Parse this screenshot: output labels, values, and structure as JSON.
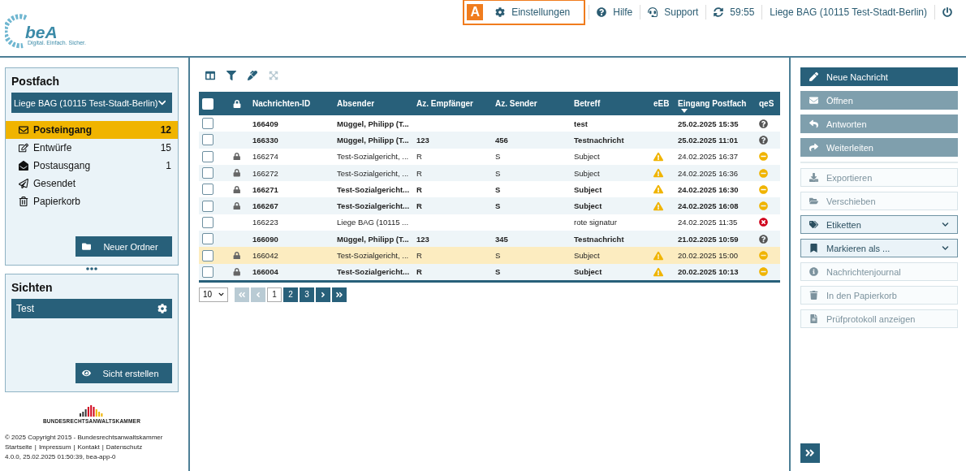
{
  "logo": {
    "name": "beA",
    "tagline": "Digital. Einfach. Sicher."
  },
  "top_bar": [
    {
      "kind": "settings",
      "badge": "A",
      "label": "Einstellungen",
      "highlighted": true
    },
    {
      "kind": "help",
      "label": "Hilfe",
      "highlighted": false
    },
    {
      "kind": "support",
      "label": "Support",
      "highlighted": false
    },
    {
      "kind": "timer",
      "label": "59:55",
      "highlighted": false
    },
    {
      "kind": "account",
      "label": "Liege BAG (10115 Test-Stadt-Berlin)",
      "highlighted": false
    },
    {
      "kind": "logout",
      "highlighted": false
    }
  ],
  "postfach": {
    "title": "Postfach",
    "mailbox": "Liege BAG (10115 Test-Stadt-Berlin)",
    "folders": [
      {
        "label": "Posteingang",
        "count": "12",
        "selected": true
      },
      {
        "label": "Entwürfe",
        "count": "15",
        "selected": false
      },
      {
        "label": "Postausgang",
        "count": "1",
        "selected": false
      },
      {
        "label": "Gesendet",
        "selected": false
      },
      {
        "label": "Papierkorb",
        "selected": false
      }
    ],
    "button": "Neuer Ordner"
  },
  "sichten": {
    "title": "Sichten",
    "views": [
      {
        "label": "Test"
      }
    ],
    "button": "Sicht erstellen"
  },
  "footer": {
    "org": "BUNDESRECHTSANWALTSKAMMER",
    "copyright": "© 2025 Copyright 2015 - Bundesrechtsanwaltskammer",
    "links": [
      "Startseite",
      "Impressum",
      "Kontakt",
      "Datenschutz"
    ],
    "link_separator": "|",
    "version": "4.0.0, 25.02.2025 01:50:39, bea-app-0"
  },
  "toolbar": [
    {
      "kind": "columns",
      "disabled": false
    },
    {
      "kind": "filter",
      "disabled": false
    },
    {
      "kind": "marker",
      "disabled": false
    },
    {
      "kind": "expand",
      "disabled": true
    }
  ],
  "table": {
    "select_all_checked": false,
    "columns": [
      {
        "label": "Nachrichten-ID",
        "sorted": false
      },
      {
        "label": "Absender",
        "sorted": false
      },
      {
        "label": "Az. Empfänger",
        "sorted": false
      },
      {
        "label": "Az. Sender",
        "sorted": false
      },
      {
        "label": "Betreff",
        "sorted": false
      },
      {
        "label": "eEB",
        "sorted": false
      },
      {
        "label": "Eingang Postfach",
        "sorted": true
      },
      {
        "label": "qeS",
        "sorted": false
      }
    ],
    "rows": [
      {
        "checked": false,
        "selected": false,
        "unread": true,
        "locked": false,
        "id": "166409",
        "sender": "Müggel, Philipp (T...",
        "az_recipient": "",
        "az_sender": "",
        "subject": "test",
        "eeb": false,
        "received": "25.02.2025 15:35",
        "kind": "unknown"
      },
      {
        "checked": false,
        "selected": false,
        "unread": true,
        "locked": false,
        "id": "166330",
        "sender": "Müggel, Philipp (T...",
        "az_recipient": "123",
        "az_sender": "456",
        "subject": "Testnachricht",
        "eeb": false,
        "received": "25.02.2025 11:01",
        "kind": "unknown"
      },
      {
        "checked": false,
        "selected": false,
        "unread": false,
        "locked": true,
        "id": "166274",
        "sender": "Test-Sozialgericht, ...",
        "az_recipient": "R",
        "az_sender": "S",
        "subject": "Subject",
        "eeb": true,
        "received": "24.02.2025 16:37",
        "kind": "pending"
      },
      {
        "checked": false,
        "selected": false,
        "unread": false,
        "locked": true,
        "id": "166272",
        "sender": "Test-Sozialgericht, ...",
        "az_recipient": "R",
        "az_sender": "S",
        "subject": "Subject",
        "eeb": true,
        "received": "24.02.2025 16:36",
        "kind": "pending"
      },
      {
        "checked": false,
        "selected": false,
        "unread": true,
        "locked": true,
        "id": "166271",
        "sender": "Test-Sozialgericht...",
        "az_recipient": "R",
        "az_sender": "S",
        "subject": "Subject",
        "eeb": true,
        "received": "24.02.2025 16:30",
        "kind": "pending"
      },
      {
        "checked": false,
        "selected": false,
        "unread": true,
        "locked": true,
        "id": "166267",
        "sender": "Test-Sozialgericht...",
        "az_recipient": "R",
        "az_sender": "S",
        "subject": "Subject",
        "eeb": true,
        "received": "24.02.2025 16:08",
        "kind": "pending"
      },
      {
        "checked": false,
        "selected": false,
        "unread": false,
        "locked": false,
        "id": "166223",
        "sender": "Liege BAG (10115 ...",
        "az_recipient": "",
        "az_sender": "",
        "subject": "rote signatur",
        "eeb": false,
        "received": "24.02.2025 11:35",
        "kind": "invalid"
      },
      {
        "checked": false,
        "selected": false,
        "unread": true,
        "locked": false,
        "id": "166090",
        "sender": "Müggel, Philipp (T...",
        "az_recipient": "123",
        "az_sender": "345",
        "subject": "Testnachricht",
        "eeb": false,
        "received": "21.02.2025 10:59",
        "kind": "unknown"
      },
      {
        "checked": false,
        "selected": true,
        "unread": false,
        "locked": true,
        "id": "166042",
        "sender": "Test-Sozialgericht, ...",
        "az_recipient": "R",
        "az_sender": "S",
        "subject": "Subject",
        "eeb": true,
        "received": "20.02.2025 15:00",
        "kind": "pending"
      },
      {
        "checked": false,
        "selected": false,
        "unread": true,
        "locked": true,
        "id": "166004",
        "sender": "Test-Sozialgericht...",
        "az_recipient": "R",
        "az_sender": "S",
        "subject": "Subject",
        "eeb": true,
        "received": "20.02.2025 10:13",
        "kind": "pending"
      }
    ]
  },
  "pagination": {
    "page_size": "10",
    "pages": [
      {
        "label": "1",
        "selected": true
      },
      {
        "label": "2",
        "selected": false
      },
      {
        "label": "3",
        "selected": false
      }
    ],
    "first_disabled": true,
    "prev_disabled": true,
    "next_disabled": false,
    "last_disabled": false
  },
  "actions": [
    {
      "label": "Neue Nachricht",
      "kind": "primary"
    },
    {
      "label": "Öffnen",
      "kind": "muted"
    },
    {
      "label": "Antworten",
      "kind": "muted"
    },
    {
      "label": "Weiterleiten",
      "kind": "muted"
    },
    {
      "kind": "divider"
    },
    {
      "label": "Exportieren",
      "kind": "outline"
    },
    {
      "label": "Verschieben",
      "kind": "outline"
    },
    {
      "label": "Etiketten",
      "kind": "dropdown"
    },
    {
      "label": "Markieren als ...",
      "kind": "dropdown"
    },
    {
      "label": "Nachrichtenjournal",
      "kind": "outline"
    },
    {
      "label": "In den Papierkorb",
      "kind": "outline"
    },
    {
      "label": "Prüfprotokoll anzeigen",
      "kind": "outline"
    }
  ]
}
